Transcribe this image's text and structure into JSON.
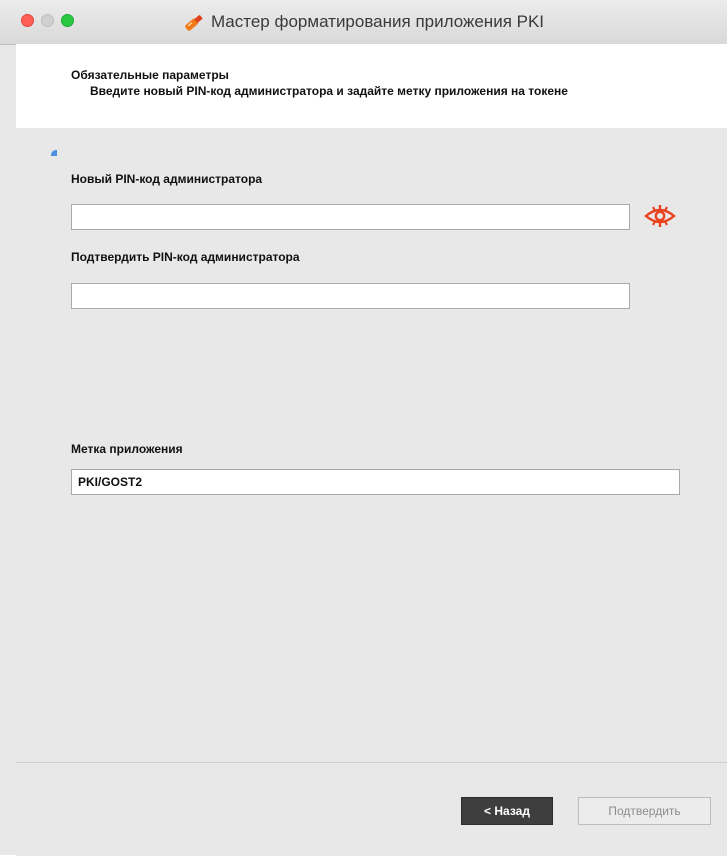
{
  "window": {
    "title": "Мастер форматирования приложения PKI"
  },
  "header": {
    "title": "Обязательные параметры",
    "description": "Введите новый PIN-код администратора и задайте метку приложения на токене"
  },
  "form": {
    "new_pin_label": "Новый PIN-код администратора",
    "new_pin_value": "",
    "confirm_pin_label": "Подтвердить PIN-код администратора",
    "confirm_pin_value": "",
    "app_label_label": "Метка приложения",
    "app_label_value": "PKI/GOST2"
  },
  "icons": {
    "app_icon": "usb-token-icon",
    "show_pin_icon": "eye-icon"
  },
  "colors": {
    "eye_icon": "#e8421f",
    "back_button_bg": "#3e3e3e",
    "marker": "#4a8fe0"
  },
  "buttons": {
    "back": "< Назад",
    "confirm": "Подтвердить"
  }
}
